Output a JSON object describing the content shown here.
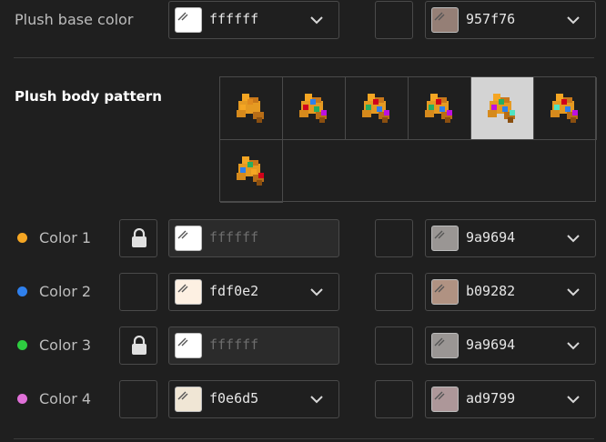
{
  "base": {
    "label": "Plush base color",
    "primary_hex": "ffffff",
    "primary_swatch": "#ffffff",
    "secondary_hex": "957f76",
    "secondary_swatch": "#957f76"
  },
  "pattern": {
    "label": "Plush body pattern",
    "selected_index": 4,
    "tiles": [
      {
        "name": "pattern-tile-1",
        "accents": [
          "#f5a623",
          "#e08a1e"
        ]
      },
      {
        "name": "pattern-tile-2",
        "accents": [
          "#d0021b",
          "#2f80ed",
          "#27ae60",
          "#bd10e0"
        ]
      },
      {
        "name": "pattern-tile-3",
        "accents": [
          "#27ae60",
          "#d0021b",
          "#2f80ed",
          "#bd10e0"
        ]
      },
      {
        "name": "pattern-tile-4",
        "accents": [
          "#27ae60",
          "#d0021b",
          "#2f80ed",
          "#bd10e0"
        ]
      },
      {
        "name": "pattern-tile-5",
        "accents": [
          "#bd10e0",
          "#27ae60",
          "#2f80ed",
          "#50e3c2"
        ]
      },
      {
        "name": "pattern-tile-6",
        "accents": [
          "#50e3c2",
          "#d0021b",
          "#2f80ed",
          "#bd10e0"
        ]
      },
      {
        "name": "pattern-tile-7",
        "accents": [
          "#2f80ed",
          "#27ae60",
          "#f5a623",
          "#d0021b"
        ]
      }
    ]
  },
  "colors": [
    {
      "label": "Color 1",
      "dot": "#f5a623",
      "locked": true,
      "primary_hex": "ffffff",
      "primary_swatch": "#ffffff",
      "secondary_hex": "9a9694",
      "secondary_swatch": "#9a9694"
    },
    {
      "label": "Color 2",
      "dot": "#2f80ed",
      "locked": false,
      "primary_hex": "fdf0e2",
      "primary_swatch": "#fdf0e2",
      "secondary_hex": "b09282",
      "secondary_swatch": "#b09282"
    },
    {
      "label": "Color 3",
      "dot": "#2ecc40",
      "locked": true,
      "primary_hex": "ffffff",
      "primary_swatch": "#ffffff",
      "secondary_hex": "9a9694",
      "secondary_swatch": "#9a9694"
    },
    {
      "label": "Color 4",
      "dot": "#e070d8",
      "locked": false,
      "primary_hex": "f0e6d5",
      "primary_swatch": "#f0e6d5",
      "secondary_hex": "ad9799",
      "secondary_swatch": "#ad9799"
    }
  ],
  "icons": {
    "lock": "lock-icon",
    "chevron": "chevron-down-icon",
    "eyedropper": "eyedropper-icon"
  }
}
